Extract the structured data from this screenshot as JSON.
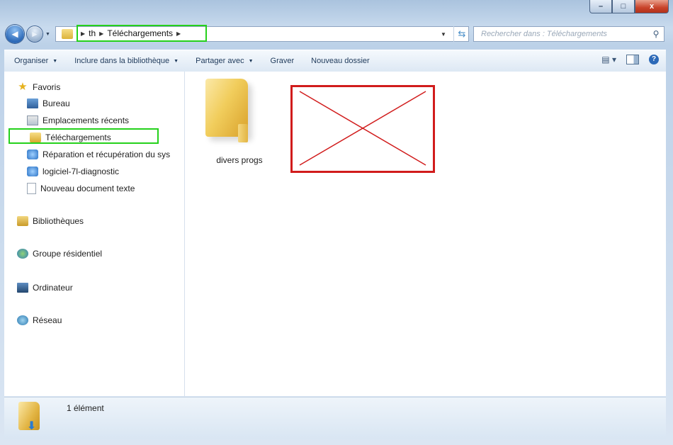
{
  "window": {
    "controls": {
      "minimize": "–",
      "maximize": "□",
      "close": "x"
    }
  },
  "nav": {
    "back_icon": "back-arrow-icon",
    "forward_icon": "forward-arrow-icon",
    "breadcrumb": [
      "th",
      "Téléchargements"
    ],
    "search_placeholder": "Rechercher dans : Téléchargements"
  },
  "toolbar": {
    "organize": "Organiser",
    "include_library": "Inclure dans la bibliothèque",
    "share": "Partager avec",
    "burn": "Graver",
    "new_folder": "Nouveau dossier"
  },
  "sidebar": {
    "favorites_label": "Favoris",
    "favorites": [
      {
        "label": "Bureau",
        "icon": "desktop-icon"
      },
      {
        "label": "Emplacements récents",
        "icon": "recent-places-icon"
      },
      {
        "label": "Téléchargements",
        "icon": "downloads-folder-icon"
      },
      {
        "label": "Réparation et récupération du sys",
        "icon": "ie-shortcut-icon"
      },
      {
        "label": "logiciel-7l-diagnostic",
        "icon": "ie-shortcut-icon"
      },
      {
        "label": "Nouveau document texte",
        "icon": "text-document-icon"
      }
    ],
    "libraries": "Bibliothèques",
    "homegroup": "Groupe résidentiel",
    "computer": "Ordinateur",
    "network": "Réseau"
  },
  "content": {
    "items": [
      {
        "label": "divers progs",
        "icon": "folder-icon"
      }
    ]
  },
  "status": {
    "count": "1 élément"
  },
  "colors": {
    "highlight_green": "#25d11b",
    "placeholder_red": "#d11c1c",
    "close_red": "#c8432a"
  }
}
